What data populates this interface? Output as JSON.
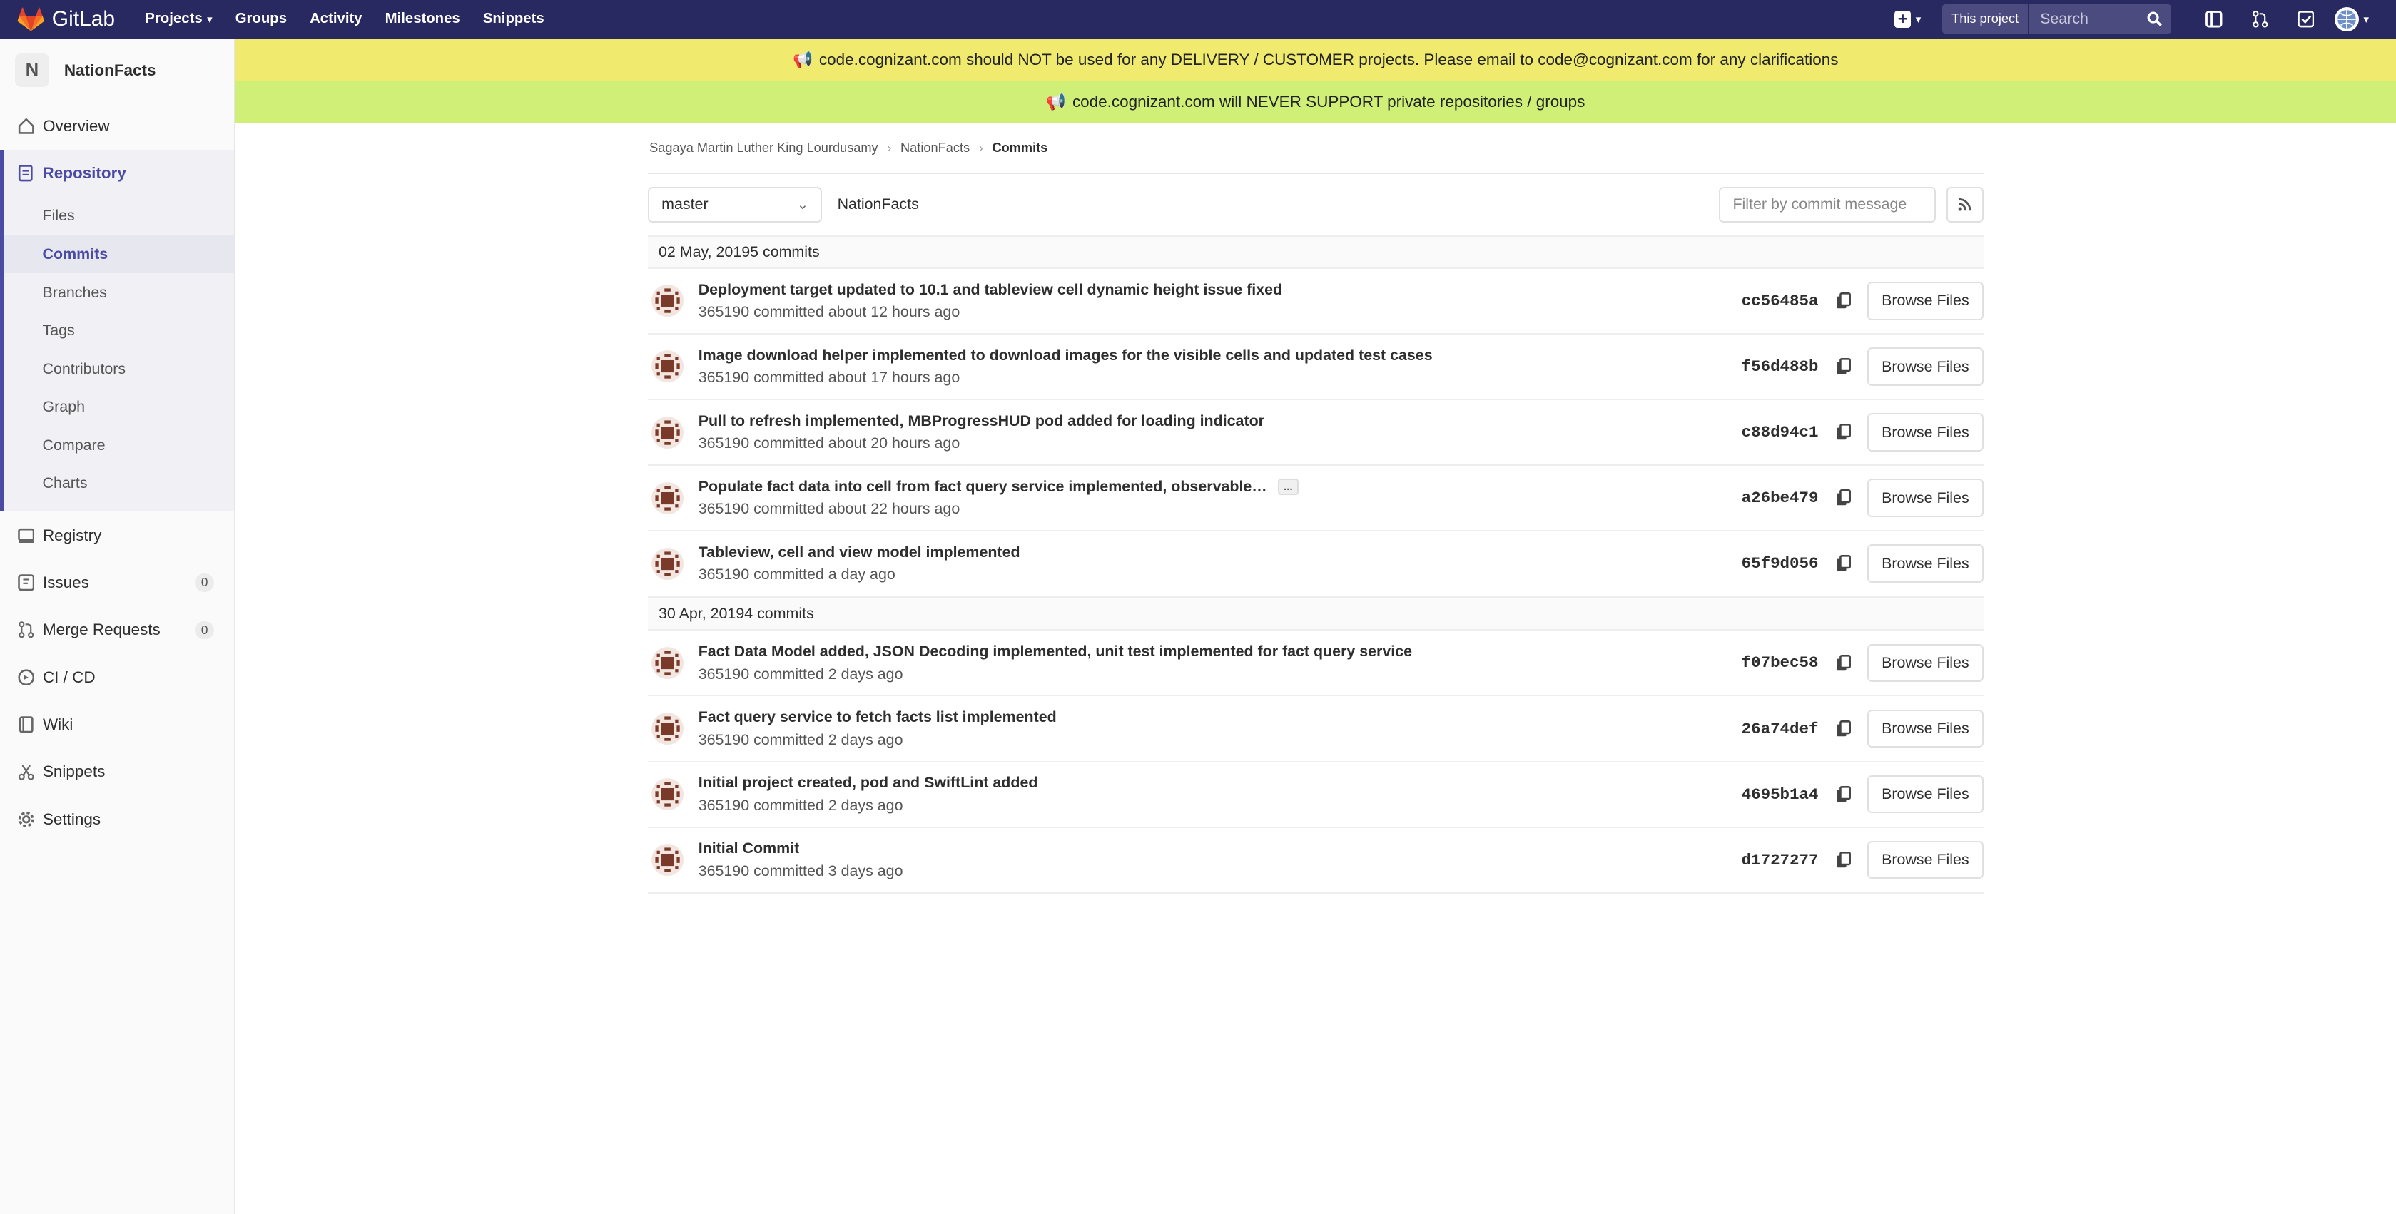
{
  "topbar": {
    "brand": "GitLab",
    "nav": [
      {
        "label": "Projects",
        "dropdown": true
      },
      {
        "label": "Groups",
        "dropdown": false
      },
      {
        "label": "Activity",
        "dropdown": false
      },
      {
        "label": "Milestones",
        "dropdown": false
      },
      {
        "label": "Snippets",
        "dropdown": false
      }
    ],
    "this_project_label": "This project",
    "search_placeholder": "Search",
    "icons": [
      "plus-icon",
      "sidebar-icon",
      "merge-request-icon",
      "todo-check-icon",
      "user-avatar-icon"
    ]
  },
  "sidebar": {
    "project_initial": "N",
    "project_name": "NationFacts",
    "items": [
      {
        "label": "Overview",
        "icon": "home-icon"
      },
      {
        "label": "Repository",
        "icon": "doc-icon"
      },
      {
        "label": "Registry",
        "icon": "registry-icon"
      },
      {
        "label": "Issues",
        "icon": "issues-icon",
        "count": "0"
      },
      {
        "label": "Merge Requests",
        "icon": "merge-icon",
        "count": "0"
      },
      {
        "label": "CI / CD",
        "icon": "rocket-icon"
      },
      {
        "label": "Wiki",
        "icon": "book-icon"
      },
      {
        "label": "Snippets",
        "icon": "scissors-icon"
      },
      {
        "label": "Settings",
        "icon": "gear-icon"
      }
    ],
    "repo_subitems": [
      "Files",
      "Commits",
      "Branches",
      "Tags",
      "Contributors",
      "Graph",
      "Compare",
      "Charts"
    ],
    "active_subitem": "Commits"
  },
  "banners": {
    "warning": "code.cognizant.com should NOT be used for any DELIVERY / CUSTOMER projects. Please email to code@cognizant.com for any clarifications",
    "notice": "code.cognizant.com will NEVER SUPPORT private repositories / groups"
  },
  "breadcrumb": [
    "Sagaya Martin Luther King Lourdusamy",
    "NationFacts",
    "Commits"
  ],
  "controls": {
    "branch": "master",
    "path": "NationFacts",
    "filter_placeholder": "Filter by commit message"
  },
  "commit_groups": [
    {
      "date": "02 May, 2019",
      "count": "5 commits",
      "commits": [
        {
          "title": "Deployment target updated to 10.1 and tableview cell dynamic height issue fixed",
          "meta": "365190 committed about 12 hours ago",
          "sha": "cc56485a",
          "truncated": false
        },
        {
          "title": "Image download helper implemented to download images for the visible cells and updated test cases",
          "meta": "365190 committed about 17 hours ago",
          "sha": "f56d488b",
          "truncated": false
        },
        {
          "title": "Pull to refresh implemented, MBProgressHUD pod added for loading indicator",
          "meta": "365190 committed about 20 hours ago",
          "sha": "c88d94c1",
          "truncated": false
        },
        {
          "title": "Populate fact data into cell from fact query service implemented, observable…",
          "meta": "365190 committed about 22 hours ago",
          "sha": "a26be479",
          "truncated": true
        },
        {
          "title": "Tableview, cell and view model implemented",
          "meta": "365190 committed a day ago",
          "sha": "65f9d056",
          "truncated": false
        }
      ]
    },
    {
      "date": "30 Apr, 2019",
      "count": "4 commits",
      "commits": [
        {
          "title": "Fact Data Model added, JSON Decoding implemented, unit test implemented for fact query service",
          "meta": "365190 committed 2 days ago",
          "sha": "f07bec58",
          "truncated": false
        },
        {
          "title": "Fact query service to fetch facts list implemented",
          "meta": "365190 committed 2 days ago",
          "sha": "26a74def",
          "truncated": false
        },
        {
          "title": "Initial project created, pod and SwiftLint added",
          "meta": "365190 committed 2 days ago",
          "sha": "4695b1a4",
          "truncated": false
        },
        {
          "title": "Initial Commit",
          "meta": "365190 committed 3 days ago",
          "sha": "d1727277",
          "truncated": false
        }
      ]
    }
  ],
  "browse_files_label": "Browse Files",
  "ellipsis_label": "...",
  "colors": {
    "topbar": "#292961",
    "accent": "#4b4ba3",
    "banner_warning": "#f0ea6e",
    "banner_notice": "#cfef77",
    "avatar": "#7a3a2a"
  }
}
